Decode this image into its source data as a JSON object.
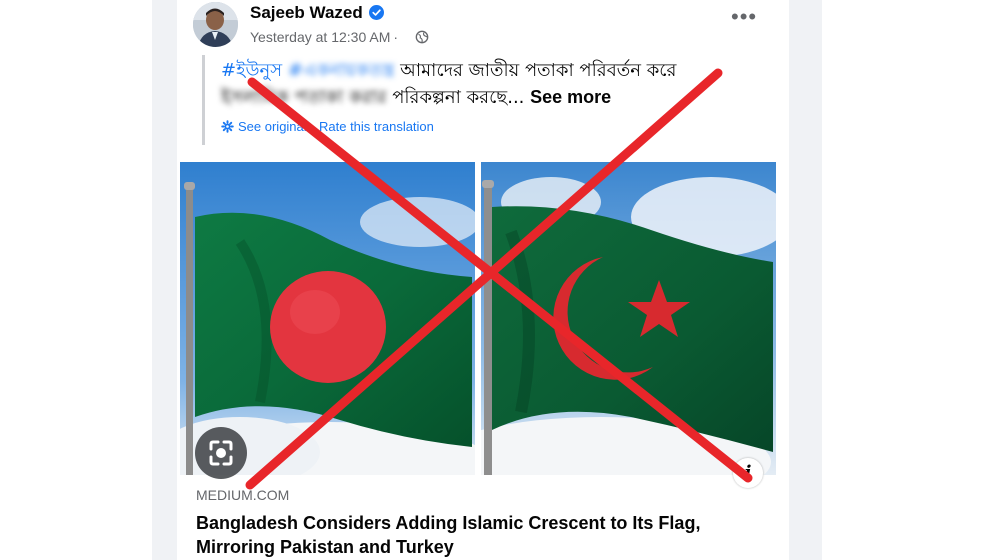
{
  "post": {
    "author": "Sajeeb Wazed",
    "timestamp": "Yesterday at 12:30 AM",
    "dot": "·",
    "more_menu": "•••",
    "hashtag_1": "#ইউনুস",
    "hashtag_2": "#একনায়কতন্ত্র",
    "text_line_1": "আমাদের জাতীয় পতাকা পরিবর্তন করে",
    "text_line_2_a": "ইসলামিক পতাকা করার",
    "text_line_2_b": "পরিকল্পনা করছে...",
    "see_more": "See more",
    "see_original": "See original",
    "separator": "·",
    "rate_translation": "Rate this translation"
  },
  "link_preview": {
    "domain": "MEDIUM.COM",
    "headline_line_1": "Bangladesh Considers Adding Islamic Crescent to Its Flag,",
    "headline_line_2": "Mirroring Pakistan and Turkey",
    "info_label": "i"
  },
  "colors": {
    "facebook_blue": "#1877f2",
    "x_mark_red": "#e8262a",
    "bangladesh_green": "#0a6a3a",
    "bangladesh_red": "#e3353f"
  },
  "icons": [
    "verified-badge-icon",
    "globe-icon",
    "more-options-icon",
    "gear-icon",
    "image-search-icon",
    "info-icon",
    "red-x-overlay"
  ]
}
